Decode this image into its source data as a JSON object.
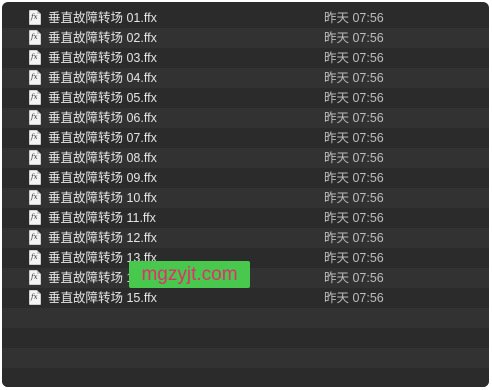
{
  "files": [
    {
      "name": "垂直故障转场 01.ffx",
      "date": "昨天 07:56",
      "icon": "fx-file-icon"
    },
    {
      "name": "垂直故障转场 02.ffx",
      "date": "昨天 07:56",
      "icon": "fx-file-icon"
    },
    {
      "name": "垂直故障转场 03.ffx",
      "date": "昨天 07:56",
      "icon": "fx-file-icon"
    },
    {
      "name": "垂直故障转场 04.ffx",
      "date": "昨天 07:56",
      "icon": "fx-file-icon"
    },
    {
      "name": "垂直故障转场 05.ffx",
      "date": "昨天 07:56",
      "icon": "fx-file-icon"
    },
    {
      "name": "垂直故障转场 06.ffx",
      "date": "昨天 07:56",
      "icon": "fx-file-icon"
    },
    {
      "name": "垂直故障转场 07.ffx",
      "date": "昨天 07:56",
      "icon": "fx-file-icon"
    },
    {
      "name": "垂直故障转场 08.ffx",
      "date": "昨天 07:56",
      "icon": "fx-file-icon"
    },
    {
      "name": "垂直故障转场 09.ffx",
      "date": "昨天 07:56",
      "icon": "fx-file-icon"
    },
    {
      "name": "垂直故障转场 10.ffx",
      "date": "昨天 07:56",
      "icon": "fx-file-icon"
    },
    {
      "name": "垂直故障转场 11.ffx",
      "date": "昨天 07:56",
      "icon": "fx-file-icon"
    },
    {
      "name": "垂直故障转场 12.ffx",
      "date": "昨天 07:56",
      "icon": "fx-file-icon"
    },
    {
      "name": "垂直故障转场 13.ffx",
      "date": "昨天 07:56",
      "icon": "fx-file-icon"
    },
    {
      "name": "垂直故障转场 14.ffx",
      "date": "昨天 07:56",
      "icon": "fx-file-icon"
    },
    {
      "name": "垂直故障转场 15.ffx",
      "date": "昨天 07:56",
      "icon": "fx-file-icon"
    }
  ],
  "icon_label": "fx",
  "watermark": "mgzyjt.com",
  "colors": {
    "background": "#2b2b2b",
    "row_alt": "#323232",
    "text": "#e4e4e4",
    "date_text": "#bdbdbd",
    "watermark_bg": "#48c84d",
    "watermark_text": "#e0306d"
  }
}
